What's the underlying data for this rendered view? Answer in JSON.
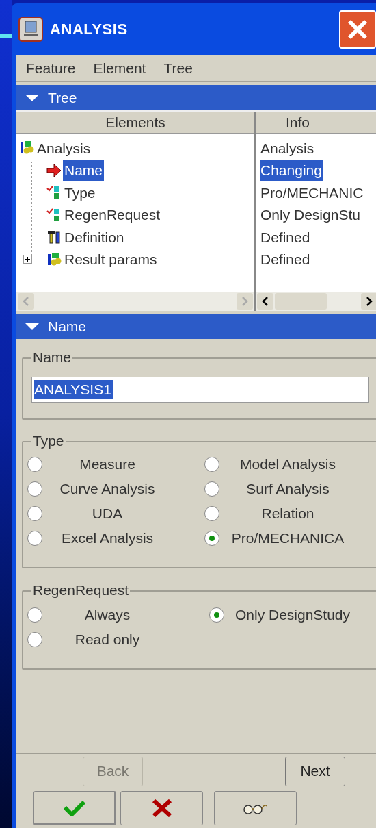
{
  "window": {
    "title": "ANALYSIS"
  },
  "menu": [
    "Feature",
    "Element",
    "Tree"
  ],
  "tree_section": {
    "header": "Tree",
    "expanded": true,
    "columns": [
      "Elements",
      "Info"
    ],
    "tree": [
      {
        "label": "Analysis",
        "info": "Analysis",
        "kind": "group",
        "selected": false,
        "children": [
          {
            "label": "Name",
            "info": "Changing",
            "kind": "current",
            "selected": true
          },
          {
            "label": "Type",
            "info": "Pro/MECHANIC",
            "kind": "element",
            "selected": false
          },
          {
            "label": "RegenRequest",
            "info": "Only DesignStu",
            "kind": "element",
            "selected": false
          },
          {
            "label": "Definition",
            "info": "Defined",
            "kind": "tool",
            "selected": false
          },
          {
            "label": "Result params",
            "info": "Defined",
            "kind": "group",
            "selected": false,
            "expanded": false
          }
        ]
      }
    ]
  },
  "name_section": {
    "header": "Name",
    "expanded": true,
    "name_group": {
      "label": "Name",
      "value": "ANALYSIS1"
    },
    "type_group": {
      "label": "Type",
      "options": [
        {
          "label": "Measure",
          "selected": false
        },
        {
          "label": "Model Analysis",
          "selected": false
        },
        {
          "label": "Curve Analysis",
          "selected": false
        },
        {
          "label": "Surf Analysis",
          "selected": false
        },
        {
          "label": "UDA",
          "selected": false
        },
        {
          "label": "Relation",
          "selected": false
        },
        {
          "label": "Excel Analysis",
          "selected": false
        },
        {
          "label": "Pro/MECHANICA",
          "selected": true
        }
      ]
    },
    "regen_group": {
      "label": "RegenRequest",
      "options": [
        {
          "label": "Always",
          "selected": false
        },
        {
          "label": "Only DesignStudy",
          "selected": true
        },
        {
          "label": "Read only",
          "selected": false
        }
      ]
    }
  },
  "nav_buttons": [
    {
      "label": "Back",
      "disabled": true
    },
    {
      "label": "Next",
      "disabled": false
    }
  ],
  "action_buttons": [
    {
      "kind": "ok"
    },
    {
      "kind": "cancel"
    },
    {
      "kind": "preview"
    }
  ]
}
